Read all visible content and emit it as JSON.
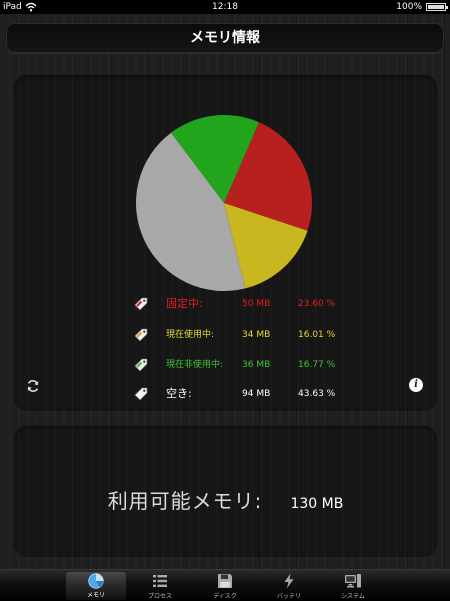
{
  "status_bar": {
    "carrier": "iPad",
    "time": "12:18",
    "battery": "100%"
  },
  "header": {
    "title": "メモリ情報"
  },
  "memory_chart": {
    "chart_data": {
      "type": "pie",
      "slices": [
        {
          "label": "固定中:",
          "mb": 50,
          "percent": 23.6,
          "color": "#b81f1f"
        },
        {
          "label": "現在使用中:",
          "mb": 34,
          "percent": 16.01,
          "color": "#c8b71f"
        },
        {
          "label": "現在非使用中:",
          "mb": 36,
          "percent": 16.77,
          "color": "#22a51d"
        },
        {
          "label": "空き:",
          "mb": 94,
          "percent": 43.63,
          "color": "#a8a8a8"
        }
      ]
    }
  },
  "legend": {
    "items": [
      {
        "label": "固定中:",
        "value": "50 MB",
        "percent": "23.60 %",
        "color": "#e0201e",
        "icon": "tag-icon-red"
      },
      {
        "label": "現在使用中:",
        "value": "34 MB",
        "percent": "16.01 %",
        "color": "#e6dc3a",
        "icon": "tag-icon-yellow"
      },
      {
        "label": "現在非使用中:",
        "value": "36 MB",
        "percent": "16.77 %",
        "color": "#3ac634",
        "icon": "tag-icon-green"
      },
      {
        "label": "空き:",
        "value": "94 MB",
        "percent": "43.63 %",
        "color": "#ffffff",
        "icon": "tag-icon-white"
      }
    ]
  },
  "available": {
    "label": "利用可能メモリ:",
    "value": "130 MB"
  },
  "tabs": [
    {
      "label": "メモリ",
      "icon": "pie-chart-icon",
      "active": true
    },
    {
      "label": "プロセス",
      "icon": "list-icon",
      "active": false
    },
    {
      "label": "ディスク",
      "icon": "floppy-disk-icon",
      "active": false
    },
    {
      "label": "バッテリ",
      "icon": "lightning-icon",
      "active": false
    },
    {
      "label": "システム",
      "icon": "computer-icon",
      "active": false
    }
  ]
}
